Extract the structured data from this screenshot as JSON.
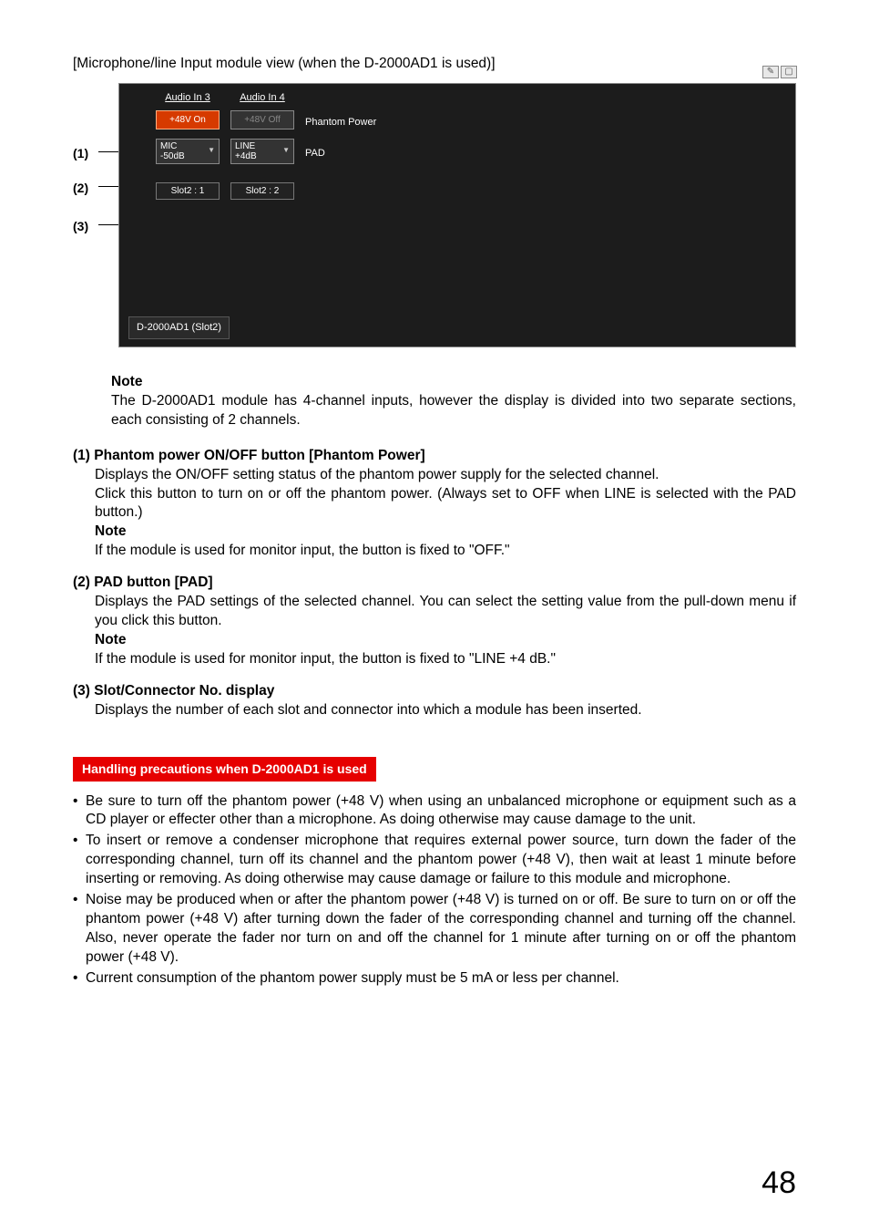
{
  "caption": "[Microphone/line Input module view (when the D-2000AD1 is used)]",
  "panel": {
    "channels": [
      {
        "label": "Audio In 3",
        "phantom": "+48V On",
        "phantom_state": "on",
        "pad_line1": "MIC",
        "pad_line2": "-50dB",
        "slot": "Slot2 : 1"
      },
      {
        "label": "Audio In 4",
        "phantom": "+48V Off",
        "phantom_state": "off",
        "pad_line1": "LINE",
        "pad_line2": "+4dB",
        "slot": "Slot2 : 2"
      }
    ],
    "row_labels": {
      "phantom": "Phantom Power",
      "pad": "PAD"
    },
    "device": "D-2000AD1 (Slot2)"
  },
  "callouts": {
    "c1": "(1)",
    "c2": "(2)",
    "c3": "(3)"
  },
  "note1": {
    "title": "Note",
    "text": "The D-2000AD1 module has 4-channel inputs, however the display is divided into two separate sections, each consisting of 2 channels."
  },
  "items": [
    {
      "num": "(1)",
      "title": "Phantom power ON/OFF button [Phantom Power]",
      "lines": [
        "Displays the ON/OFF setting status of the phantom power supply for the selected channel.",
        "Click this button to turn on or off the phantom power. (Always set to OFF when LINE is selected with the PAD button.)"
      ],
      "note_title": "Note",
      "note": "If the module is used for monitor input, the button is fixed to \"OFF.\""
    },
    {
      "num": "(2)",
      "title": "PAD button [PAD]",
      "lines": [
        "Displays the PAD settings of the selected channel. You can select the setting value from the pull-down menu if you click this button."
      ],
      "note_title": "Note",
      "note": "If the module is used for monitor input, the button is fixed to \"LINE +4 dB.\""
    },
    {
      "num": "(3)",
      "title": "Slot/Connector No. display",
      "lines": [
        "Displays the number of each slot and connector into which a module has been inserted."
      ]
    }
  ],
  "precaution_title": "Handling precautions when D-2000AD1 is used",
  "precautions": [
    "Be sure to turn off the phantom power (+48 V) when using an unbalanced microphone or equipment such as a CD player or effecter other than a microphone. As doing otherwise may cause damage to the unit.",
    "To insert or remove a condenser microphone that requires external power source, turn down the fader of the corresponding channel, turn off its channel and the phantom power (+48 V), then wait at least 1 minute before inserting or removing. As doing otherwise may cause damage or failure to this module and microphone.",
    "Noise may be produced when or after the phantom power (+48 V) is turned on or off. Be sure to turn on or off the phantom power (+48 V) after turning down the fader of the corresponding channel and turning off the channel. Also, never operate the fader nor turn on and off the channel for 1 minute after turning on or off the phantom power (+48 V).",
    "Current consumption of the phantom power supply must be 5 mA or less per channel."
  ],
  "page_number": "48"
}
